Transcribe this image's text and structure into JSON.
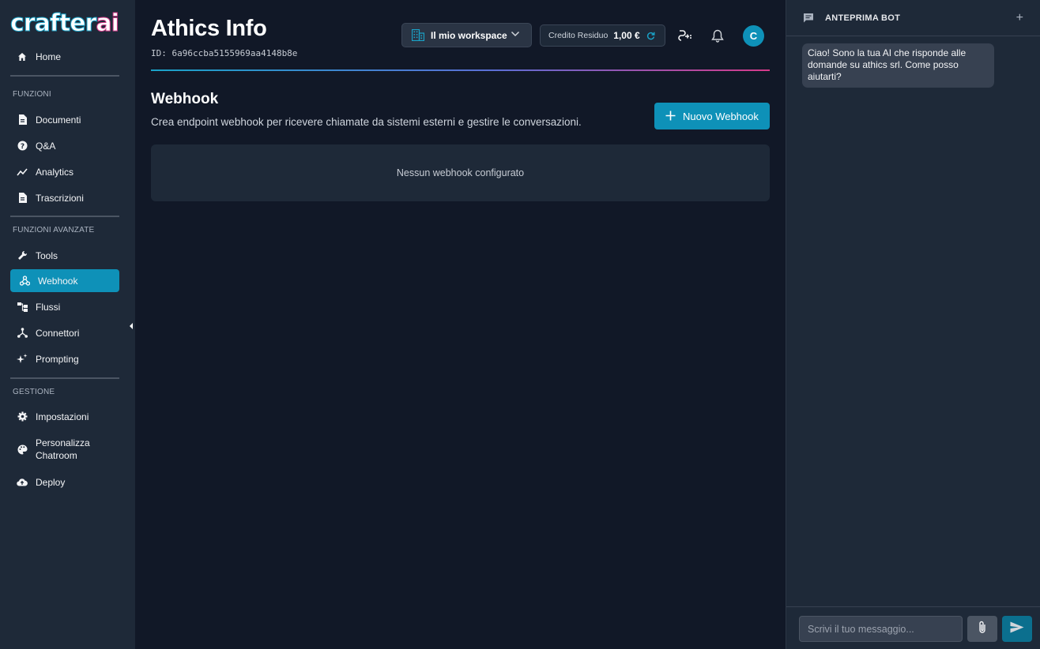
{
  "app": {
    "logo_main": "crafter",
    "logo_accent": "ai",
    "brand_color": "#0e91b8",
    "accent_pink": "#d63a8a"
  },
  "sidebar": {
    "home": {
      "label": "Home",
      "icon": "home-icon"
    },
    "sections": [
      {
        "label": "FUNZIONI",
        "items": [
          {
            "label": "Documenti",
            "icon": "document-icon"
          },
          {
            "label": "Q&A",
            "icon": "help-icon"
          },
          {
            "label": "Analytics",
            "icon": "analytics-icon"
          },
          {
            "label": "Trascrizioni",
            "icon": "transcript-icon"
          }
        ]
      },
      {
        "label": "FUNZIONI AVANZATE",
        "items": [
          {
            "label": "Tools",
            "icon": "wrench-icon"
          },
          {
            "label": "Webhook",
            "icon": "webhook-icon",
            "active": true
          },
          {
            "label": "Flussi",
            "icon": "flow-icon"
          },
          {
            "label": "Connettori",
            "icon": "connector-icon"
          },
          {
            "label": "Prompting",
            "icon": "sparkle-icon"
          }
        ]
      },
      {
        "label": "GESTIONE",
        "items": [
          {
            "label": "Impostazioni",
            "icon": "gear-icon"
          },
          {
            "label": "Personalizza Chatroom",
            "icon": "palette-icon"
          },
          {
            "label": "Deploy",
            "icon": "cloud-upload-icon"
          }
        ]
      }
    ]
  },
  "header": {
    "title": "Athics Info",
    "id_text": "ID: 6a96ccba5155969aa4148b8e",
    "workspace_label": "Il mio workspace",
    "credit_label": "Credito Residuo",
    "credit_value": "1,00 €",
    "avatar_initial": "C"
  },
  "main": {
    "section_title": "Webhook",
    "section_desc": "Crea endpoint webhook per ricevere chiamate da sistemi esterni e gestire le conversazioni.",
    "new_button_label": "Nuovo Webhook",
    "empty_text": "Nessun webhook configurato"
  },
  "preview": {
    "title": "ANTEPRIMA BOT",
    "add_label": "+",
    "bot_message": "Ciao! Sono la tua AI che risponde alle domande su athics srl. Come posso aiutarti?",
    "input_placeholder": "Scrivi il tuo messaggio..."
  }
}
